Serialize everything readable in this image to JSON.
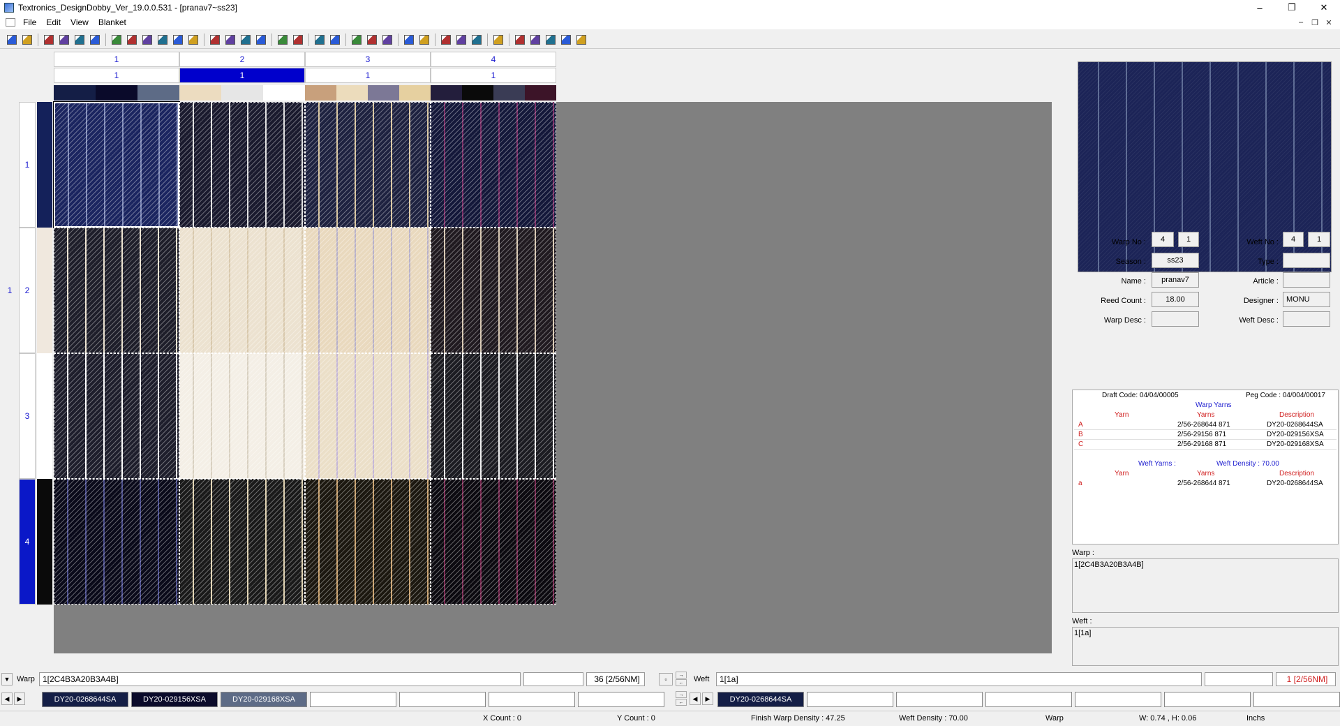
{
  "window": {
    "title": "Textronics_DesignDobby_Ver_19.0.0.531 - [pranav7~ss23]",
    "controls": [
      "–",
      "❐",
      "✕"
    ],
    "mdi_controls": [
      "–",
      "❐",
      "✕"
    ]
  },
  "menu": [
    "File",
    "Edit",
    "View",
    "Blanket"
  ],
  "toolbar_icons": [
    "new-icon",
    "open-icon",
    "sep",
    "save-icon",
    "save-as-icon",
    "save-all-icon",
    "export-icon",
    "sep",
    "open-folder-icon",
    "import-icon",
    "save-design-icon",
    "copy-icon",
    "paste-icon",
    "print-icon",
    "sep",
    "grid-icon",
    "grid-dots-icon",
    "color-icon",
    "palette-icon",
    "sep",
    "zoom-in-icon",
    "zoom-out-icon",
    "sep",
    "fit-icon",
    "layout-icon",
    "sep",
    "thread-icon",
    "thread2-icon",
    "thread3-icon",
    "sep",
    "insert-col-icon",
    "insert-row-icon",
    "sep",
    "check-icon",
    "check2-icon",
    "check3-icon",
    "sep",
    "check4-icon",
    "sep",
    "fill-icon",
    "pattern-icon",
    "frame-icon",
    "hatch-icon",
    "network-icon"
  ],
  "blanket": {
    "col_numbers": [
      "1",
      "2",
      "3",
      "4"
    ],
    "col_counts": [
      "1",
      "1",
      "1",
      "1"
    ],
    "selected_col": 1,
    "col_swatches": [
      [
        "#141e46",
        "#0a0a2a",
        "#5d6b86"
      ],
      [
        "#ecdcc0",
        "#e6e6e6",
        "#ffffff"
      ],
      [
        "#c8a07c",
        "#ecdcbc",
        "#7c7896",
        "#e6d0a0"
      ],
      [
        "#231e3c",
        "#0a0a0a",
        "#3a3c55",
        "#3c1428"
      ]
    ],
    "row_numbers_outer": [
      "1"
    ],
    "row_numbers": [
      "1",
      "2",
      "3",
      "4"
    ],
    "selected_row": 3,
    "row_swatches": [
      "#14215a",
      "#f0e8de",
      "#ffffff",
      "#0a0a0a"
    ],
    "cell_colors": [
      [
        "#1b2560",
        "#1a1a2e",
        "#1e2240",
        "#14183a"
      ],
      [
        "#1e1e2a",
        "#ece2d0",
        "#e9d9be",
        "#201a20"
      ],
      [
        "#1e1e2c",
        "#f4efe6",
        "#ebdfc8",
        "#1c1c22"
      ],
      [
        "#0a0a1a",
        "#1a1a1a",
        "#1c1810",
        "#0c0a10"
      ]
    ],
    "cell_stripes": [
      [
        "#7f8ab8",
        "#e0e0e0",
        "#d8c59e",
        "#7b2e66"
      ],
      [
        "#ede3d0",
        "#d8c8ac",
        "#b7b0c8",
        "#d6c6b0"
      ],
      [
        "#ffffff",
        "#d8d0c0",
        "#c4b6d6",
        "#f0f0f0"
      ],
      [
        "#4b4e8e",
        "#e0d2b0",
        "#c8a06c",
        "#7a2a52"
      ]
    ]
  },
  "right_panel": {
    "fields": {
      "warp_no_label": "Warp No :",
      "warp_no": "4",
      "warp_no2": "1",
      "weft_no_label": "Weft No :",
      "weft_no": "4",
      "weft_no2": "1",
      "season_label": "Season :",
      "season": "ss23",
      "type_label": "Type :",
      "type": "",
      "name_label": "Name :",
      "name": "pranav7",
      "article_label": "Article :",
      "article": "",
      "reed_label": "Reed Count :",
      "reed": "18.00",
      "designer_label": "Designer :",
      "designer": "MONU",
      "warp_desc_label": "Warp Desc :",
      "warp_desc": "",
      "weft_desc_label": "Weft Desc :",
      "weft_desc": ""
    },
    "yarn_table": {
      "draft_code": "Draft Code: 04/04/00005",
      "peg_code": "Peg Code : 04/004/00017",
      "warp_title": "Warp Yarns",
      "headers": [
        "Yarn",
        "Yarns",
        "Description"
      ],
      "warp_rows": [
        {
          "key": "A",
          "yarns": "2/56-268644 871",
          "desc": "DY20-0268644SA"
        },
        {
          "key": "B",
          "yarns": "2/56-29156 871",
          "desc": "DY20-029156XSA"
        },
        {
          "key": "C",
          "yarns": "2/56-29168 871",
          "desc": "DY20-029168XSA"
        }
      ],
      "weft_title": "Weft Yarns :",
      "weft_density": "Weft Density : 70.00",
      "weft_rows": [
        {
          "key": "a",
          "yarns": "2/56-268644 871",
          "desc": "DY20-0268644SA"
        }
      ]
    },
    "warp_label": "Warp :",
    "warp_value": "1[2C4B3A20B3A4B]",
    "weft_label": "Weft :",
    "weft_value": "1[1a]"
  },
  "bottom": {
    "warp_label": "Warp",
    "warp_value": "1[2C4B3A20B3A4B]",
    "warp_count": "36 [2/56NM]",
    "weft_label": "Weft",
    "weft_value": "1[1a]",
    "weft_count": "1 [2/56NM]",
    "warp_chips": [
      {
        "label": "DY20-0268644SA",
        "color": "#141e46"
      },
      {
        "label": "DY20-029156XSA",
        "color": "#0a0a2a"
      },
      {
        "label": "DY20-029168XSA",
        "color": "#5d6b86"
      }
    ],
    "weft_chips": [
      {
        "label": "DY20-0268644SA",
        "color": "#141e46"
      }
    ]
  },
  "status": {
    "x_count": "X Count : 0",
    "y_count": "Y Count : 0",
    "finish_warp": "Finish Warp Density : 47.25",
    "weft_density": "Weft Density : 70.00",
    "mode": "Warp",
    "wh": "W: 0.74 , H: 0.06",
    "unit": "Inchs"
  }
}
